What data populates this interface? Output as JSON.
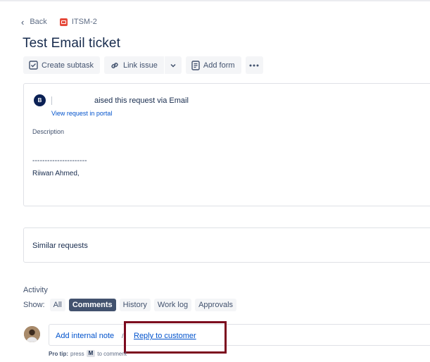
{
  "breadcrumb": {
    "back_label": "Back",
    "issue_key": "ITSM-2"
  },
  "issue": {
    "title": "Test Email ticket"
  },
  "toolbar": {
    "create_subtask": "Create subtask",
    "link_issue": "Link issue",
    "add_form": "Add form"
  },
  "request": {
    "avatar_initial": "B",
    "raised_text": "aised this request via",
    "channel": "Email",
    "view_portal": "View request in portal",
    "description_label": "Description",
    "description_dashes": "----------------------",
    "signature": "Riiwan Ahmed,"
  },
  "similar": {
    "label": "Similar requests"
  },
  "activity": {
    "label": "Activity",
    "show_label": "Show:",
    "filters": [
      {
        "label": "All"
      },
      {
        "label": "Comments"
      },
      {
        "label": "History"
      },
      {
        "label": "Work log"
      },
      {
        "label": "Approvals"
      }
    ],
    "active_filter": "Comments"
  },
  "comment": {
    "internal_note": "Add internal note",
    "separator": "/",
    "reply_customer": "Reply to customer",
    "protip_prefix": "Pro tip:",
    "protip_press": "press",
    "protip_key": "M",
    "protip_suffix": "to comment"
  },
  "colors": {
    "link": "#0052cc",
    "chip_active": "#42526e",
    "highlight_box": "#7c0a1e",
    "issue_type": "#e5493a"
  }
}
